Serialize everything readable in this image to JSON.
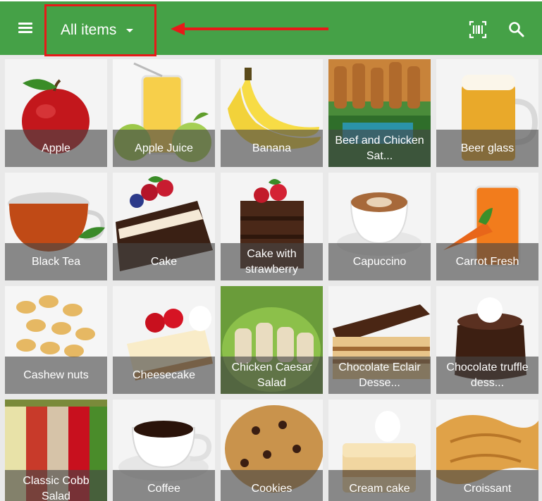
{
  "toolbar": {
    "category_label": "All items",
    "bg_color": "#45a147",
    "icons": [
      "menu-icon",
      "chevron-down-icon",
      "barcode-scan-icon",
      "search-icon"
    ]
  },
  "annotation": {
    "color": "#e81919"
  },
  "items": [
    {
      "name": "Apple"
    },
    {
      "name": "Apple Juice"
    },
    {
      "name": "Banana"
    },
    {
      "name": "Beef and Chicken Sat..."
    },
    {
      "name": "Beer glass"
    },
    {
      "name": "Black Tea"
    },
    {
      "name": "Cake"
    },
    {
      "name": "Cake with strawberry"
    },
    {
      "name": "Capuccino"
    },
    {
      "name": "Carrot Fresh"
    },
    {
      "name": "Cashew nuts"
    },
    {
      "name": "Cheesecake"
    },
    {
      "name": "Chicken Caesar Salad"
    },
    {
      "name": "Chocolate Eclair Desse..."
    },
    {
      "name": "Chocolate truffle dess..."
    },
    {
      "name": "Classic Cobb Salad"
    },
    {
      "name": "Coffee"
    },
    {
      "name": "Cookies"
    },
    {
      "name": "Cream cake"
    },
    {
      "name": "Croissant"
    }
  ]
}
